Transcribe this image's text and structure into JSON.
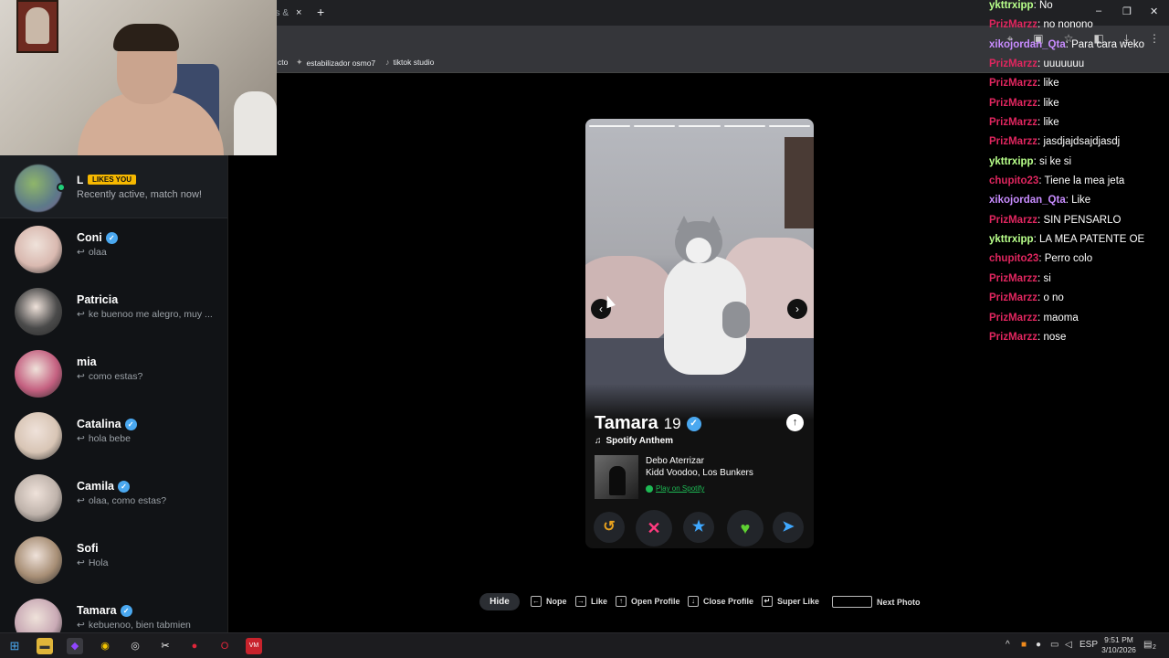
{
  "browser": {
    "tab_label": "ds &",
    "tab_close": "×",
    "new_tab": "+",
    "window_controls": [
      "–",
      "❐",
      "✕"
    ],
    "bookmarks": [
      {
        "label": "cto",
        "icon": ""
      },
      {
        "label": "estabilizador osmo7",
        "icon": "sparkle-icon"
      },
      {
        "label": "tiktok studio",
        "icon": "tiktok-icon"
      }
    ]
  },
  "sidebar": {
    "likes": {
      "name": "L",
      "badge": "LIKES YOU",
      "subtitle": "Recently active, match now!"
    },
    "conversations": [
      {
        "name": "Coni",
        "verified": true,
        "message": "olaa"
      },
      {
        "name": "Patricia",
        "verified": false,
        "message": "ke buenoo me alegro, muy ..."
      },
      {
        "name": "mia",
        "verified": false,
        "message": "como estas?"
      },
      {
        "name": "Catalina",
        "verified": true,
        "message": "hola bebe"
      },
      {
        "name": "Camila",
        "verified": true,
        "message": "olaa, como estas?"
      },
      {
        "name": "Sofi",
        "verified": false,
        "message": "Hola"
      },
      {
        "name": "Tamara",
        "verified": true,
        "message": "kebuenoo, bien tabmien"
      }
    ],
    "reply_glyph": "↩"
  },
  "card": {
    "name": "Tamara",
    "age": "19",
    "anthem_label": "Spotify Anthem",
    "song": "Debo Aterrizar",
    "artist": "Kidd Voodoo, Los Bunkers",
    "play_label": "Play on Spotify",
    "photo_count": 5,
    "nav_prev": "‹",
    "nav_next": "›",
    "open_profile": "↑",
    "actions": [
      {
        "name": "rewind",
        "glyph": "↺",
        "color": "#e9a21e"
      },
      {
        "name": "nope",
        "glyph": "✕",
        "color": "#ff3b7f"
      },
      {
        "name": "super-like",
        "glyph": "★",
        "color": "#3fa8ff"
      },
      {
        "name": "like",
        "glyph": "♥",
        "color": "#5ed132"
      },
      {
        "name": "boost",
        "glyph": "➤",
        "color": "#3fa8ff"
      }
    ]
  },
  "hints": {
    "hide": "Hide",
    "items": [
      {
        "key": "←",
        "label": "Nope"
      },
      {
        "key": "→",
        "label": "Like"
      },
      {
        "key": "↑",
        "label": "Open Profile"
      },
      {
        "key": "↓",
        "label": "Close Profile"
      },
      {
        "key": "↵",
        "label": "Super Like"
      },
      {
        "key": "",
        "label": "Next Photo"
      }
    ]
  },
  "chat": [
    {
      "user": "ykttrxipp",
      "color": "#b8ff8a",
      "text": "No"
    },
    {
      "user": "PrizMarzz",
      "color": "#e0265f",
      "text": "no nonono"
    },
    {
      "user": "xikojordan_Qta",
      "color": "#c88cff",
      "text": "Para cara weko"
    },
    {
      "user": "PrizMarzz",
      "color": "#e0265f",
      "text": "uuuuuuu"
    },
    {
      "user": "PrizMarzz",
      "color": "#e0265f",
      "text": "like"
    },
    {
      "user": "PrizMarzz",
      "color": "#e0265f",
      "text": "like"
    },
    {
      "user": "PrizMarzz",
      "color": "#e0265f",
      "text": "like"
    },
    {
      "user": "PrizMarzz",
      "color": "#e0265f",
      "text": "jasdjajdsajdjasdj"
    },
    {
      "user": "ykttrxipp",
      "color": "#b8ff8a",
      "text": "si ke si"
    },
    {
      "user": "chupito23",
      "color": "#e0265f",
      "text": "Tiene la mea jeta"
    },
    {
      "user": "xikojordan_Qta",
      "color": "#c88cff",
      "text": "Like"
    },
    {
      "user": "PrizMarzz",
      "color": "#e0265f",
      "text": "SIN PENSARLO"
    },
    {
      "user": "ykttrxipp",
      "color": "#b8ff8a",
      "text": "LA MEA PATENTE OE"
    },
    {
      "user": "chupito23",
      "color": "#e0265f",
      "text": "Perro colo"
    },
    {
      "user": "PrizMarzz",
      "color": "#e0265f",
      "text": "si"
    },
    {
      "user": "PrizMarzz",
      "color": "#e0265f",
      "text": "o no"
    },
    {
      "user": "PrizMarzz",
      "color": "#e0265f",
      "text": "maoma"
    },
    {
      "user": "PrizMarzz",
      "color": "#e0265f",
      "text": "nose"
    }
  ],
  "taskbar": {
    "language": "ESP",
    "time": "9:51 PM",
    "date": "3/10/2026",
    "notifications": "2"
  }
}
